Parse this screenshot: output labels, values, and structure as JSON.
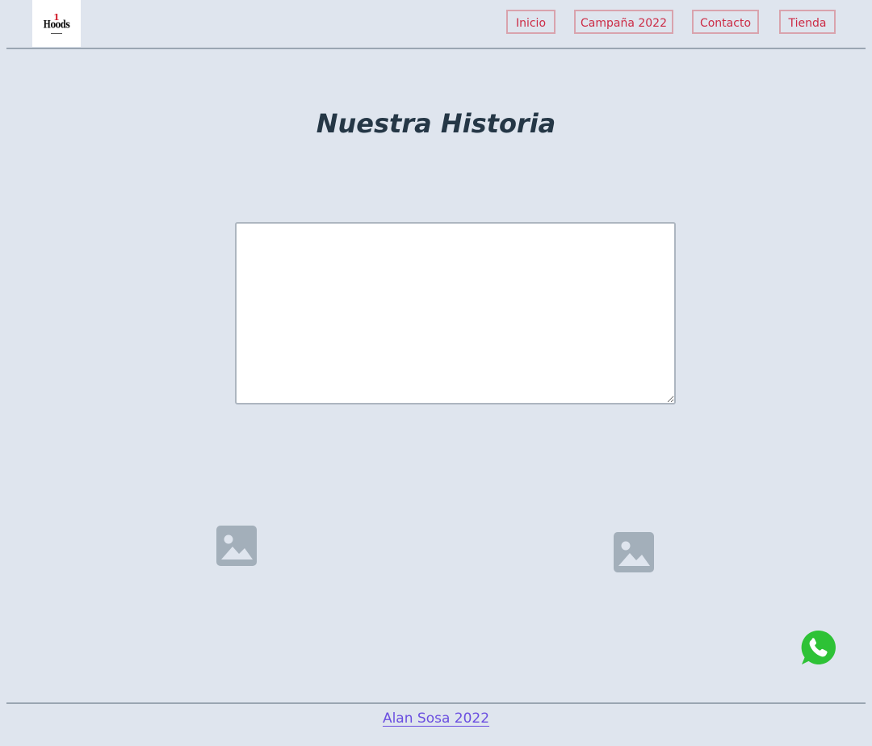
{
  "header": {
    "logo": {
      "number": "1",
      "text": "Hoods"
    },
    "nav": [
      {
        "label": "Inicio"
      },
      {
        "label": "Campaña 2022"
      },
      {
        "label": "Contacto"
      },
      {
        "label": "Tienda"
      }
    ]
  },
  "main": {
    "title": "Nuestra Historia",
    "story_textarea": {
      "value": ""
    },
    "images": [
      {
        "icon": "broken-image-icon"
      },
      {
        "icon": "broken-image-icon"
      }
    ]
  },
  "whatsapp": {
    "icon": "whatsapp-icon",
    "color": "#2ec236"
  },
  "footer": {
    "link_text": "Alan Sosa 2022"
  },
  "colors": {
    "background": "#dfe5ee",
    "nav_text": "#cc2b45",
    "nav_border": "#d9a3ad",
    "title": "#253746",
    "footer_link": "#6b4fe0",
    "placeholder_icon": "#a3afba"
  }
}
